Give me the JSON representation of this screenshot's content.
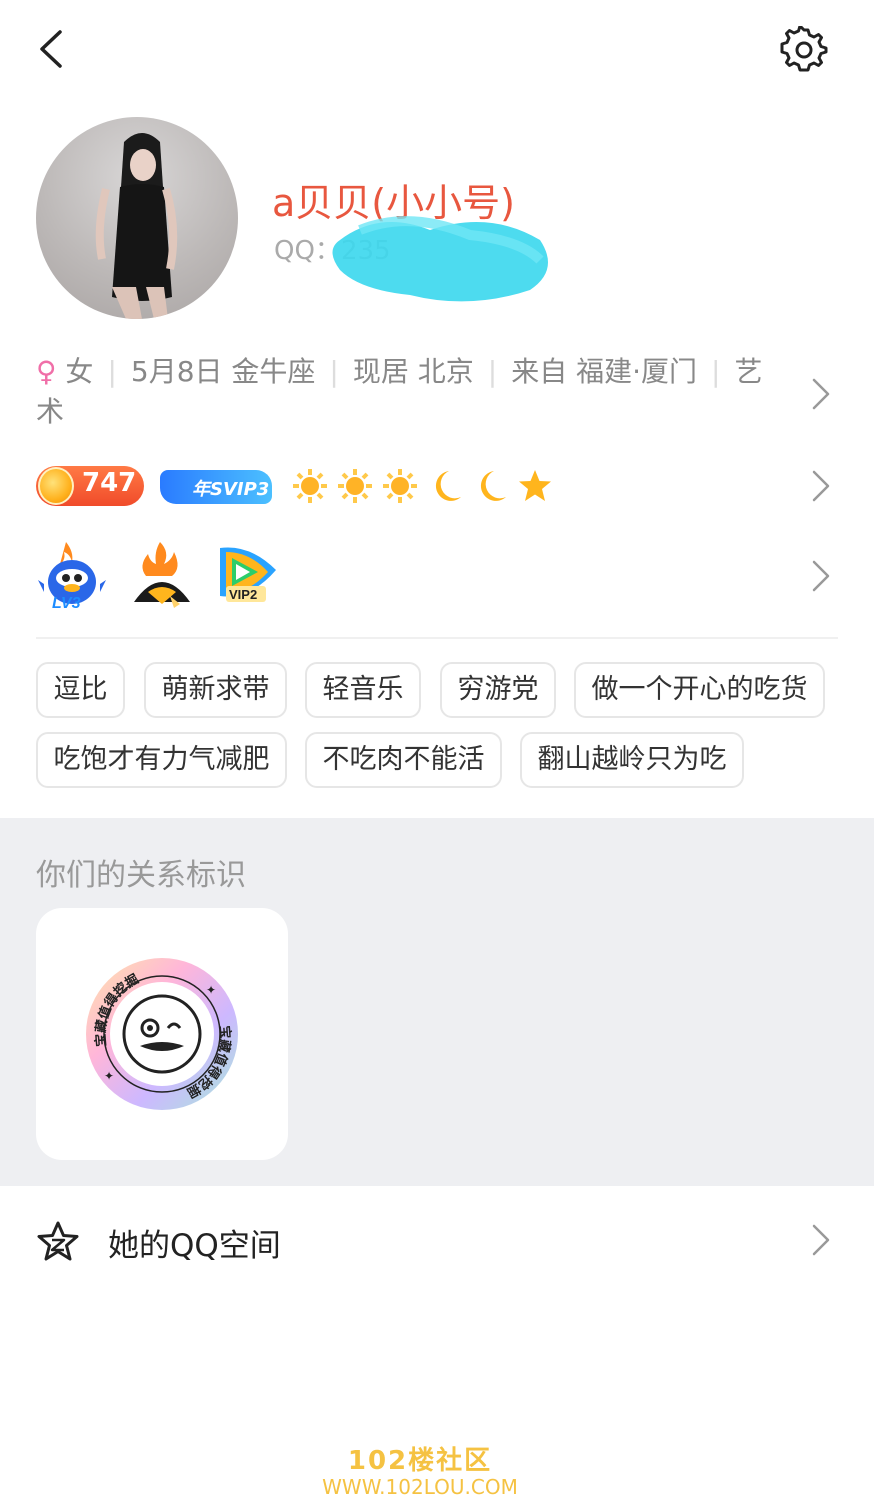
{
  "profile": {
    "nickname": "a贝贝(小小号)",
    "qq_label": "QQ：",
    "qq_number_visible": "235"
  },
  "info": {
    "gender": "女",
    "birthday": "5月8日 金牛座",
    "residence": "现居 北京",
    "hometown": "来自 福建·厦门",
    "profession": "艺术"
  },
  "badges": {
    "coin_level": "747",
    "svip_label": "年SVIP3",
    "level_icons": [
      "sun-icon",
      "sun-icon",
      "sun-icon",
      "moon-icon",
      "moon-icon",
      "star-icon"
    ]
  },
  "privileges": [
    "LV3",
    "",
    "VIP2"
  ],
  "tags": [
    "逗比",
    "萌新求带",
    "轻音乐",
    "穷游党",
    "做一个开心的吃货",
    "吃饱才有力气减肥",
    "不吃肉不能活",
    "翻山越岭只为吃"
  ],
  "relation": {
    "title": "你们的关系标识",
    "badge_text": "宝藏值得挖掘"
  },
  "qzone": {
    "label": "她的QQ空间"
  },
  "watermark": {
    "title": "102楼社区",
    "url": "WWW.102LOU.COM"
  },
  "colors": {
    "nickname": "#e8573f",
    "female": "#f06fa8",
    "section_bg": "#eeeff2"
  }
}
